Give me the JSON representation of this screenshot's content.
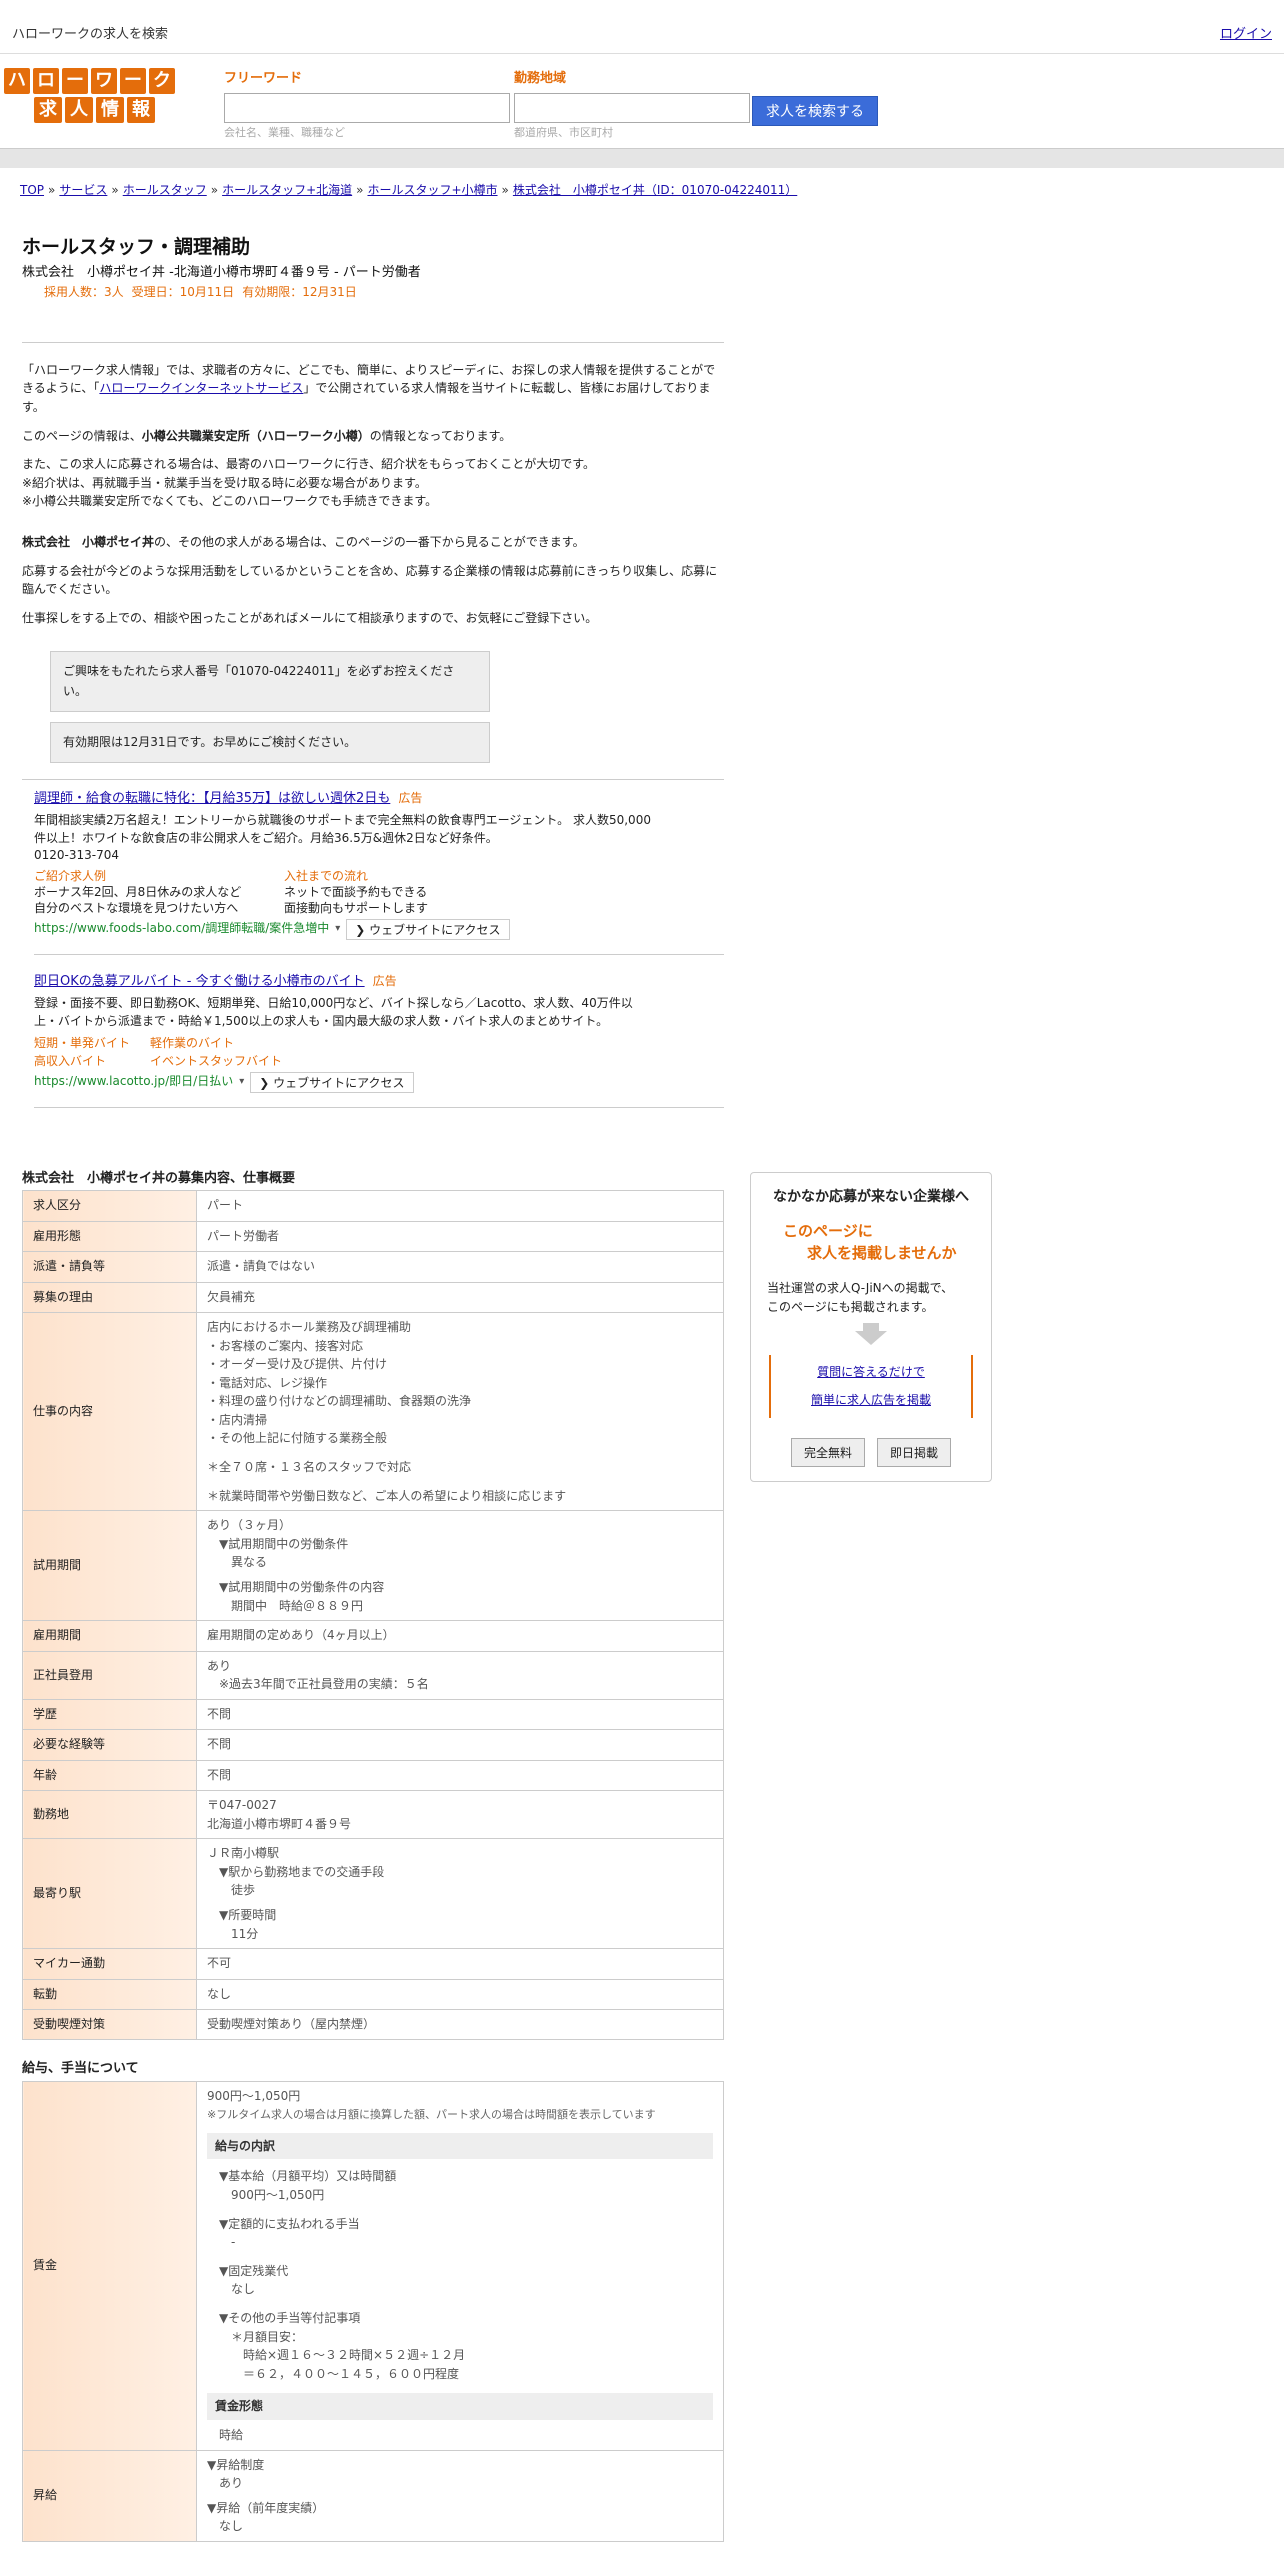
{
  "topbar": {
    "site_title": "ハローワークの求人を検索",
    "login": "ログイン"
  },
  "logo": {
    "row1": [
      "ハ",
      "ロ",
      "ー",
      "ワ",
      "ー",
      "ク"
    ],
    "row2": [
      "求",
      "人",
      "情",
      "報"
    ]
  },
  "search": {
    "keyword_label": "フリーワード",
    "keyword_hint": "会社名、業種、職種など",
    "area_label": "勤務地域",
    "area_hint": "都道府県、市区町村",
    "button": "求人を検索する"
  },
  "breadcrumb": [
    "TOP",
    "サービス",
    "ホールスタッフ",
    "ホールスタッフ+北海道",
    "ホールスタッフ+小樽市",
    "株式会社　小樽ポセイ丼（ID：01070-04224011）"
  ],
  "job": {
    "title": "ホールスタッフ・調理補助",
    "subtitle": "株式会社　小樽ポセイ丼 -北海道小樽市堺町４番９号 - パート労働者",
    "meta_hires": "採用人数：3人",
    "meta_received": "受理日：10月11日",
    "meta_expiry": "有効期限：12月31日"
  },
  "intro": {
    "p1_a": "「ハローワーク求人情報」では、求職者の方々に、どこでも、簡単に、よりスピーディに、お探しの求人情報を提供することができるように、「",
    "p1_link": "ハローワークインターネットサービス",
    "p1_b": "」で公開されている求人情報を当サイトに転載し、皆様にお届けしております。",
    "p2_a": "このページの情報は、",
    "p2_b": "小樽公共職業安定所（ハローワーク小樽）",
    "p2_c": "の情報となっております。",
    "p3_l1": "また、この求人に応募される場合は、最寄のハローワークに行き、紹介状をもらっておくことが大切です。",
    "p3_l2": "※紹介状は、再就職手当・就業手当を受け取る時に必要な場合があります。",
    "p3_l3": "※小樽公共職業安定所でなくても、どこのハローワークでも手続きできます。",
    "p4_a": "株式会社　小樽ポセイ丼",
    "p4_b": "の、その他の求人がある場合は、このページの一番下から見ることができます。",
    "p5": "応募する会社が今どのような採用活動をしているかということを含め、応募する企業様の情報は応募前にきっちり収集し、応募に臨んでください。",
    "p6": "仕事探しをする上での、相談や困ったことがあればメールにて相談承りますので、お気軽にご登録下さい。",
    "notice1": "ご興味をもたれたら求人番号「01070-04224011」を必ずお控えください。",
    "notice2": "有効期限は12月31日です。お早めにご検討ください。"
  },
  "ads": [
    {
      "title": "調理師・給食の転職に特化：【月給35万】は欲しい週休2日も",
      "tag": "広告",
      "desc": "年間相談実績2万名超え！エントリーから就職後のサポートまで完全無料の飲食専門エージェント。 求人数50,000件以上！ホワイトな飲食店の非公開求人をご紹介。月給36.5万&週休2日など好条件。",
      "phone": "0120-313-704",
      "link1_title": "ご紹介求人例",
      "link1_l1": "ボーナス年2回、月8日休みの求人など",
      "link1_l2": "自分のベストな環境を見つけたい方へ",
      "link2_title": "入社までの流れ",
      "link2_l1": "ネットで面談予約もできる",
      "link2_l2": "面接動向もサポートします",
      "url": "https://www.foods-labo.com/調理師転職/案件急増中",
      "visit": "❯ ウェブサイトにアクセス"
    },
    {
      "title": "即日OKの急募アルバイト - 今すぐ働ける小樽市のバイト",
      "tag": "広告",
      "desc": "登録・面接不要、即日勤務OK、短期単発、日給10,000円など、バイト探しなら／Lacotto、求人数、40万件以上・バイトから派遣まで・時給￥1,500以上の求人も・国内最大級の求人数・バイト求人のまとめサイト。",
      "link1": "短期・単発バイト",
      "link2": "軽作業のバイト",
      "link3": "高収入バイト",
      "link4": "イベントスタッフバイト",
      "url": "https://www.lacotto.jp/即日/日払い",
      "visit": "❯ ウェブサイトにアクセス"
    }
  ],
  "section1_title": "株式会社　小樽ポセイ丼の募集内容、仕事概要",
  "table1": {
    "r1_h": "求人区分",
    "r1_v": "パート",
    "r2_h": "雇用形態",
    "r2_v": "パート労働者",
    "r3_h": "派遣・請負等",
    "r3_v": "派遣・請負ではない",
    "r4_h": "募集の理由",
    "r4_v": "欠員補充",
    "r5_h": "仕事の内容",
    "r5_l1": "店内におけるホール業務及び調理補助",
    "r5_l2": "・お客様のご案内、接客対応",
    "r5_l3": "・オーダー受け及び提供、片付け",
    "r5_l4": "・電話対応、レジ操作",
    "r5_l5": "・料理の盛り付けなどの調理補助、食器類の洗浄",
    "r5_l6": "・店内清掃",
    "r5_l7": "・その他上記に付随する業務全般",
    "r5_l8": "＊全７０席・１３名のスタッフで対応",
    "r5_l9": "＊就業時間帯や労働日数など、ご本人の希望により相談に応じます",
    "r6_h": "試用期間",
    "r6_l1": "あり（３ヶ月）",
    "r6_l2": "▼試用期間中の労働条件",
    "r6_l3": "異なる",
    "r6_l4": "▼試用期間中の労働条件の内容",
    "r6_l5": "期間中　時給＠８８９円",
    "r7_h": "雇用期間",
    "r7_v": "雇用期間の定めあり（4ヶ月以上）",
    "r8_h": "正社員登用",
    "r8_l1": "あり",
    "r8_l2": "※過去3年間で正社員登用の実績：５名",
    "r9_h": "学歴",
    "r9_v": "不問",
    "r10_h": "必要な経験等",
    "r10_v": "不問",
    "r11_h": "年齢",
    "r11_v": "不問",
    "r12_h": "勤務地",
    "r12_l1": "〒047-0027",
    "r12_l2": "北海道小樽市堺町４番９号",
    "r13_h": "最寄り駅",
    "r13_l1": "ＪＲ南小樽駅",
    "r13_l2": "▼駅から勤務地までの交通手段",
    "r13_l3": "徒歩",
    "r13_l4": "▼所要時間",
    "r13_l5": "11分",
    "r14_h": "マイカー通勤",
    "r14_v": "不可",
    "r15_h": "転勤",
    "r15_v": "なし",
    "r16_h": "受動喫煙対策",
    "r16_v": "受動喫煙対策あり（屋内禁煙）"
  },
  "section2_title": "給与、手当について",
  "table2": {
    "r1_h": "賃金",
    "r1_wage": "900円〜1,050円",
    "r1_note": "※フルタイム求人の場合は月額に換算した額、パート求人の場合は時間額を表示しています",
    "r1_sub1": "給与の内訳",
    "r1_l1": "▼基本給（月額平均）又は時間額",
    "r1_l2": "900円〜1,050円",
    "r1_l3": "▼定額的に支払われる手当",
    "r1_l4": "-",
    "r1_l5": "▼固定残業代",
    "r1_l6": "なし",
    "r1_l7": "▼その他の手当等付記事項",
    "r1_l8": "＊月額目安：",
    "r1_l9": "時給×週１６～３２時間×５２週÷１２月",
    "r1_l10": "＝６２，４００～１４５，６００円程度",
    "r1_sub2": "賃金形態",
    "r1_l11": "時給",
    "r2_h": "昇給",
    "r2_l1": "▼昇給制度",
    "r2_l2": "あり",
    "r2_l3": "▼昇給（前年度実績）",
    "r2_l4": "なし"
  },
  "sidebox": {
    "title": "なかなか応募が来ない企業様へ",
    "catch1": "このページに",
    "catch2": "求人を掲載しませんか",
    "desc1": "当社運営の求人Q-JiNへの掲載で、",
    "desc2": "このページにも掲載されます。",
    "link1": "質問に答えるだけで",
    "link2": "簡単に求人広告を掲載",
    "btn1": "完全無料",
    "btn2": "即日掲載"
  },
  "colors": {
    "accent": "#e46d0b",
    "link": "#1a0dab",
    "ad_url": "#1a8a2e",
    "button": "#3b6cd9"
  }
}
